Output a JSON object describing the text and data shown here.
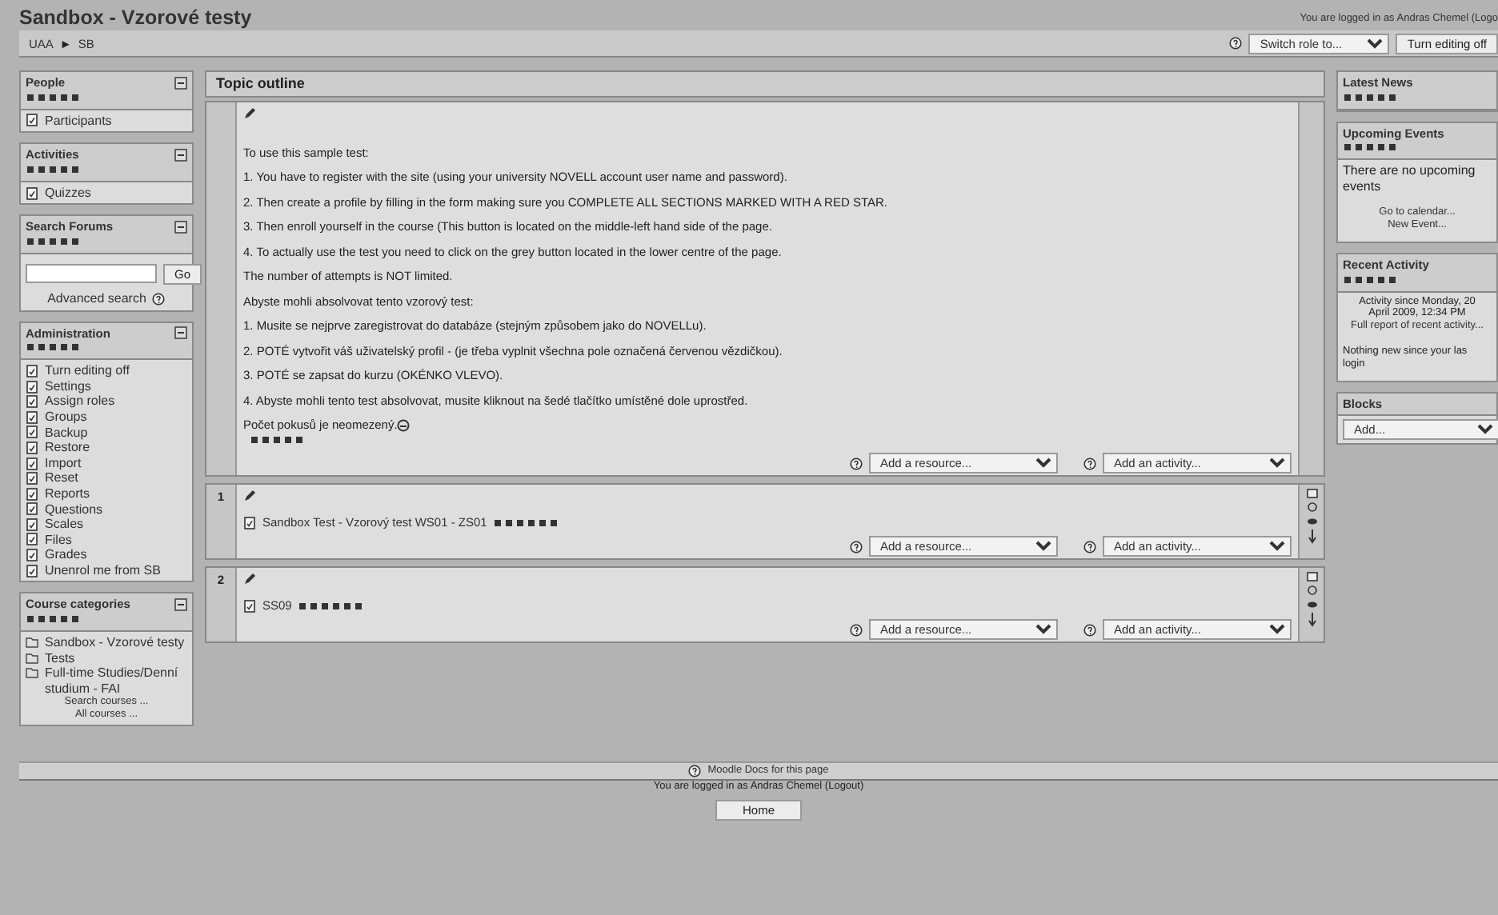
{
  "header": {
    "title": "Sandbox - Vzorové testy",
    "login_info": "You are logged in as Andras Chemel (Logo"
  },
  "navbar": {
    "breadcrumb": [
      "UAA",
      "SB"
    ],
    "separator": "►",
    "switch_role": "Switch role to...",
    "editing_button": "Turn editing off"
  },
  "left_blocks": [
    {
      "kind": "links",
      "title": "People",
      "items": [
        "Participants"
      ]
    },
    {
      "kind": "links",
      "title": "Activities",
      "items": [
        "Quizzes"
      ]
    },
    {
      "kind": "search",
      "title": "Search Forums",
      "button": "Go",
      "link": "Advanced search"
    },
    {
      "kind": "links",
      "title": "Administration",
      "items": [
        "Turn editing off",
        "Settings",
        "Assign roles",
        "Groups",
        "Backup",
        "Restore",
        "Import",
        "Reset",
        "Reports",
        "Questions",
        "Scales",
        "Files",
        "Grades",
        "Unenrol me from SB"
      ]
    },
    {
      "kind": "categories",
      "title": "Course categories",
      "items": [
        "Sandbox - Vzorové testy",
        "Tests",
        "Full-time Studies/Denní studium - FAI"
      ],
      "links": [
        "Search courses ...",
        "All courses ..."
      ]
    }
  ],
  "topic_outline": {
    "title": "Topic outline",
    "sections": [
      {
        "paragraphs": [
          "To use this sample test:",
          "1. You have to register with the site (using your university NOVELL account user name and password).",
          "2. Then create a profile by filling in the form making sure you COMPLETE ALL SECTIONS MARKED WITH A RED STAR.",
          "3. Then enroll yourself in the course (This button is located on the middle-left hand side of the page.",
          "4. To actually use the test you need to click on the grey button located in the lower centre of the page.",
          "The number of attempts is NOT limited.",
          "Abyste mohli absolvovat tento vzorový test:",
          "1. Musite se nejprve zaregistrovat do databáze (stejným způsobem jako do NOVELLu).",
          "2. POTÉ vytvořit váš uživatelský profil - (je třeba vyplnit všechna pole označená červenou vězdičkou).",
          "3. POTÉ se zapsat do kurzu (OKÉNKO VLEVO).",
          "4. Abyste mohli tento test absolvovat, musite kliknout na šedé tlačítko umístěné dole uprostřed.",
          "Počet pokusů je neomezený."
        ],
        "add_resource": "Add a resource...",
        "add_activity": "Add an activity..."
      },
      {
        "number": "1",
        "activities": [
          "Sandbox Test - Vzorový test WS01 - ZS01"
        ],
        "add_resource": "Add a resource...",
        "add_activity": "Add an activity..."
      },
      {
        "number": "2",
        "activities": [
          "SS09"
        ],
        "add_resource": "Add a resource...",
        "add_activity": "Add an activity..."
      }
    ]
  },
  "right_blocks": [
    {
      "kind": "news",
      "title": "Latest News"
    },
    {
      "kind": "events",
      "title": "Upcoming Events",
      "text": "There are no upcoming events",
      "links": [
        "Go to calendar...",
        "New Event..."
      ]
    },
    {
      "kind": "recent",
      "title": "Recent Activity",
      "lines": [
        "Activity since Monday, 20",
        "April 2009, 12:34 PM"
      ],
      "link": "Full report of recent activity...",
      "note_lines": [
        "Nothing new since your las",
        "login"
      ]
    },
    {
      "kind": "add",
      "title": "Blocks",
      "select": "Add..."
    }
  ],
  "footer": {
    "docs_link": "Moodle Docs for this page",
    "login_info": "You are logged in as Andras Chemel (Logout)",
    "home_button": "Home"
  }
}
